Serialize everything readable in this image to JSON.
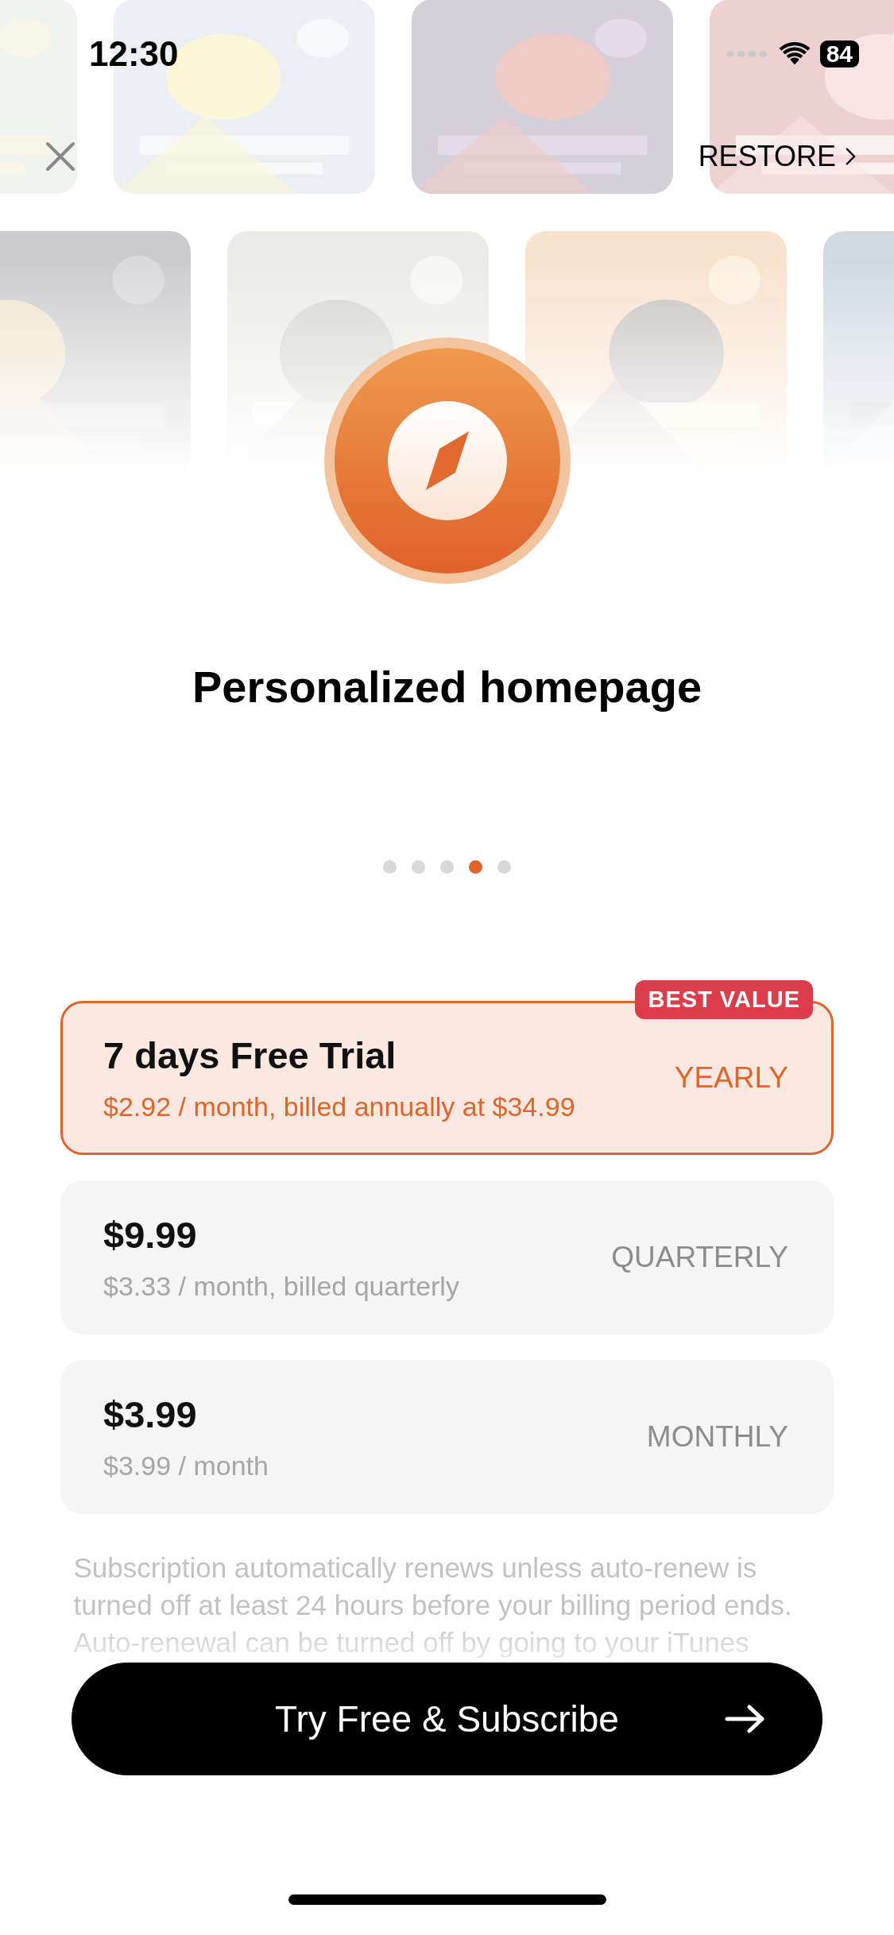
{
  "status_bar": {
    "time": "12:30",
    "battery": "84"
  },
  "nav": {
    "restore": "RESTORE"
  },
  "feature": {
    "title": "Personalized homepage"
  },
  "pager": [
    {
      "selected": false
    },
    {
      "selected": false
    },
    {
      "selected": false
    },
    {
      "selected": true
    },
    {
      "selected": false
    }
  ],
  "plans": [
    {
      "title": "7 days Free Trial",
      "detail": "$2.92 / month, billed annually at $34.99",
      "period": "YEARLY",
      "badge": "BEST VALUE",
      "selected": true
    },
    {
      "title": "$9.99",
      "detail": "$3.33 / month, billed quarterly",
      "period": "QUARTERLY",
      "selected": false
    },
    {
      "title": "$3.99",
      "detail": "$3.99 / month",
      "period": "MONTHLY",
      "selected": false
    }
  ],
  "legal": "Subscription automatically renews unless auto-renew is turned off at least 24 hours before your billing period ends. Auto-renewal can be turned off by going to your iTunes",
  "cta": {
    "label": "Try Free & Subscribe"
  }
}
